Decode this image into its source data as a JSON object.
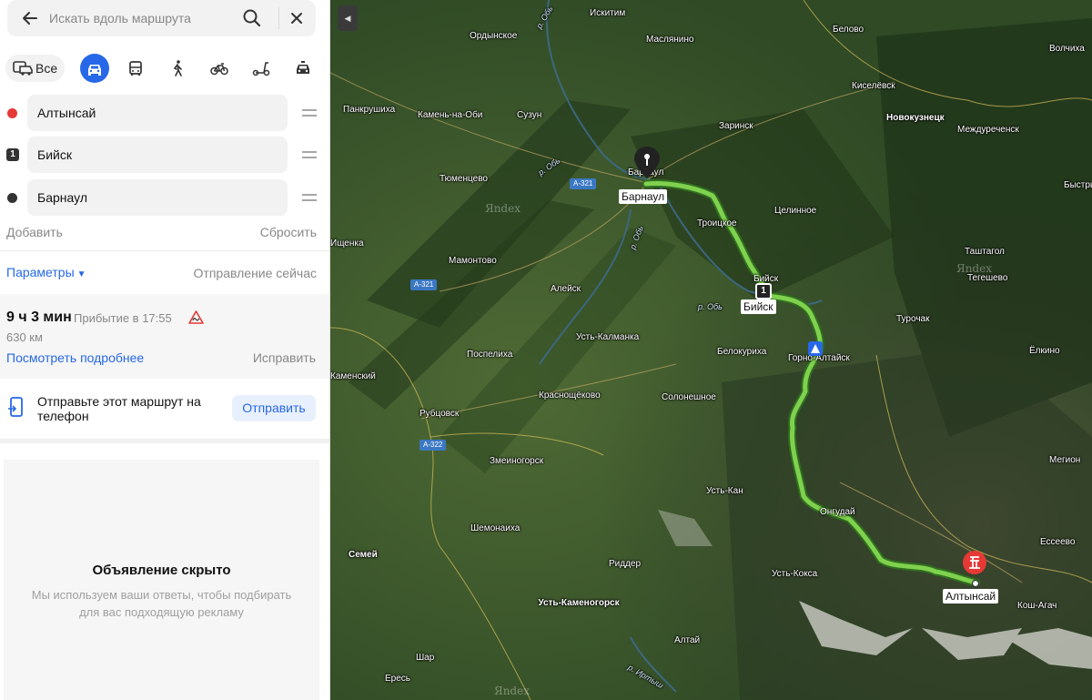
{
  "search": {
    "placeholder": "Искать вдоль маршрута"
  },
  "modes": {
    "all_label": "Все",
    "active": "car"
  },
  "waypoints": [
    {
      "label": "Алтынсай",
      "marker": "red-dot",
      "color": "#e53935"
    },
    {
      "label": "Бийск",
      "marker": "1"
    },
    {
      "label": "Барнаул",
      "marker": "dark-dot",
      "color": "#333333"
    }
  ],
  "actions": {
    "add": "Добавить",
    "reset": "Сбросить"
  },
  "params": {
    "label": "Параметры",
    "departure": "Отправление сейчас"
  },
  "route": {
    "duration": "9 ч 3 мин",
    "arrival": "Прибытие в 17:55",
    "distance": "630 км",
    "details_link": "Посмотреть подробнее",
    "fix_link": "Исправить"
  },
  "send": {
    "text": "Отправьте этот маршрут на телефон",
    "button": "Отправить"
  },
  "ad": {
    "title": "Объявление скрыто",
    "description": "Мы используем ваши ответы, чтобы подбирать для вас подходящую рекламу"
  },
  "map": {
    "route_color": "#7fd14e",
    "route_start": "Барнаул",
    "route_via": "Бийск",
    "route_via_num": "1",
    "route_end": "Алтынсай",
    "places": [
      "Искитим",
      "Ордынское",
      "Маслянино",
      "Белово",
      "Киселёвск",
      "Панкрушиха",
      "Камень-на-Оби",
      "Сузун",
      "Новокузнецк",
      "Заринск",
      "Междуреченск",
      "Тюменцево",
      "Барнаул",
      "Целинное",
      "Троицкое",
      "Таштагол",
      "Мамонтово",
      "Алейск",
      "Бийск",
      "Турочак",
      "Усть-Калманка",
      "Белокуриха",
      "Поспелиха",
      "Горно-Алтайск",
      "Краснощёково",
      "Солонешное",
      "Рубцовск",
      "Змеиногорск",
      "Усть-Кан",
      "Шемонаиха",
      "Онгудай",
      "Семей",
      "Риддер",
      "Усть-Кокса",
      "Усть-Каменогорск",
      "Кош-Агач",
      "Алтай",
      "Шар",
      "Ищенка",
      "Каменский",
      "Волчиха",
      "Быстрый",
      "Ёлкино",
      "Мегион",
      "Ересь",
      "Ессеево",
      "Тегешево"
    ],
    "rivers": [
      "р. Обь",
      "р. Обь",
      "р. Обь",
      "р. Обь",
      "р. Иртыш"
    ],
    "highways": [
      "А-321",
      "А-321",
      "А-322"
    ],
    "watermark": "Яndex"
  }
}
